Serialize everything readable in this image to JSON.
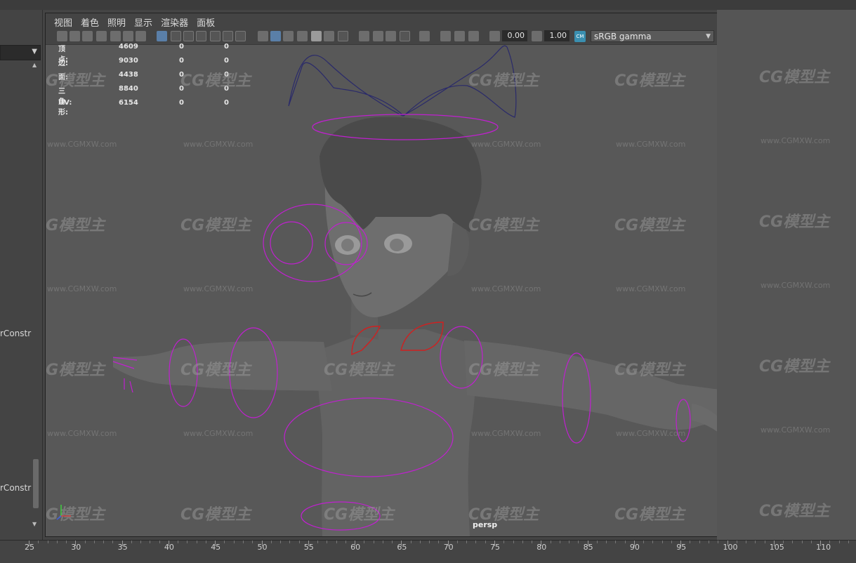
{
  "viewport_menu": [
    "视图",
    "着色",
    "照明",
    "显示",
    "渲染器",
    "面板"
  ],
  "toolbar": {
    "exposure_value": "0.00",
    "gamma_value": "1.00",
    "color_mgmt_label": "sRGB gamma"
  },
  "heads_up": [
    {
      "label": "顶点:",
      "v1": "4609",
      "v2": "0",
      "v3": "0"
    },
    {
      "label": "边:",
      "v1": "9030",
      "v2": "0",
      "v3": "0"
    },
    {
      "label": "面:",
      "v1": "4438",
      "v2": "0",
      "v3": "0"
    },
    {
      "label": "三角形:",
      "v1": "8840",
      "v2": "0",
      "v3": "0"
    },
    {
      "label": "UV:",
      "v1": "6154",
      "v2": "0",
      "v3": "0"
    }
  ],
  "camera_label": "persp",
  "left_panel": {
    "label_1": "rConstr",
    "label_2": "rConstr"
  },
  "timeline_ticks": [
    "25",
    "30",
    "35",
    "40",
    "45",
    "50",
    "55",
    "60",
    "65",
    "70",
    "75",
    "80",
    "85",
    "90",
    "95",
    "100",
    "105",
    "110"
  ],
  "watermark": {
    "brand": "CG模型主",
    "url": "www.CGMXW.com"
  },
  "colors": {
    "control_curve": "#c020d0",
    "hair_curve": "#2a2a6a",
    "fk_control": "#d02020",
    "viewport_bg": "#585858"
  }
}
